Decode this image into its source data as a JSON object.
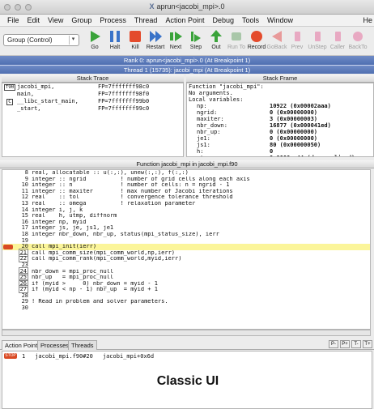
{
  "window": {
    "title": "aprun<jacobi_mpi>.0"
  },
  "menu": [
    "File",
    "Edit",
    "View",
    "Group",
    "Process",
    "Thread",
    "Action Point",
    "Debug",
    "Tools",
    "Window"
  ],
  "menu_help": "He",
  "toolbar": {
    "group_select": "Group (Control)",
    "buttons": [
      {
        "label": "Go",
        "icon": "go-icon",
        "color": "#3aa33a",
        "enabled": true
      },
      {
        "label": "Halt",
        "icon": "halt-icon",
        "color": "#3a73c8",
        "enabled": true
      },
      {
        "label": "Kill",
        "icon": "kill-icon",
        "color": "#e44b2c",
        "enabled": true
      },
      {
        "label": "Restart",
        "icon": "restart-icon",
        "color": "#3a73c8",
        "enabled": true
      },
      {
        "label": "Next",
        "icon": "next-icon",
        "color": "#3aa33a",
        "enabled": true
      },
      {
        "label": "Step",
        "icon": "step-icon",
        "color": "#3aa33a",
        "enabled": true
      },
      {
        "label": "Out",
        "icon": "out-icon",
        "color": "#3aa33a",
        "enabled": true
      },
      {
        "label": "Run To",
        "icon": "run-to-icon",
        "color": "#a9c7a9",
        "enabled": false
      },
      {
        "label": "Record",
        "icon": "record-icon",
        "color": "#e44b2c",
        "enabled": true
      },
      {
        "label": "GoBack",
        "icon": "goback-icon",
        "color": "#e89a9a",
        "enabled": false
      },
      {
        "label": "Prev",
        "icon": "prev-icon",
        "color": "#e8a9c2",
        "enabled": false
      },
      {
        "label": "UnStep",
        "icon": "unstep-icon",
        "color": "#e8a9c2",
        "enabled": false
      },
      {
        "label": "Caller",
        "icon": "caller-icon",
        "color": "#e8a9c2",
        "enabled": false
      },
      {
        "label": "BackTo",
        "icon": "backto-icon",
        "color": "#e8a9c2",
        "enabled": false
      },
      {
        "label": "L",
        "icon": "live-icon",
        "color": "#e8a9c2",
        "enabled": false
      }
    ]
  },
  "rank_bar": "Rank 0: aprun<jacobi_mpi>.0 (At Breakpoint 1)",
  "thread_bar": "Thread 1 (15735): jacobi_mpi (At Breakpoint 1)",
  "stack_trace": {
    "header": "Stack Trace",
    "rows": [
      {
        "lang": "f90",
        "func": "jacobi_mpi,",
        "fp": "FP=7fffffff98c0"
      },
      {
        "lang": "",
        "func": "main,",
        "fp": "FP=7fffffff98f0"
      },
      {
        "lang": "C",
        "func": "__libc_start_main,",
        "fp": "FP=7fffffff99b0"
      },
      {
        "lang": "",
        "func": "_start,",
        "fp": "FP=7fffffff99c0"
      }
    ]
  },
  "stack_frame": {
    "header": "Stack Frame",
    "lines": [
      "Function \"jacobi_mpi\":",
      " No arguments.",
      "Local variables:"
    ],
    "vars": [
      {
        "name": "np:",
        "value": "10922 (0x00002aaa)"
      },
      {
        "name": "ngrid:",
        "value": "0 (0x00000000)"
      },
      {
        "name": "maxiter:",
        "value": "3 (0x00000003)"
      },
      {
        "name": "nbr_down:",
        "value": "16877 (0x000041ed)"
      },
      {
        "name": "nbr_up:",
        "value": "0 (0x00000000)"
      },
      {
        "name": "je1:",
        "value": "0 (0x00000000)"
      },
      {
        "name": "js1:",
        "value": "80 (0x00000050)"
      },
      {
        "name": "h:",
        "value": "0"
      },
      {
        "name": "utmp:",
        "value": "0 0000e-44 (denormalized)"
      }
    ]
  },
  "source": {
    "header": "Function jacobi_mpi in jacobi_mpi.f90",
    "lines": [
      {
        "n": "8",
        "t": "real, allocatable :: u(:,:), unew(:,:), f(:,:)"
      },
      {
        "n": "9",
        "t": "integer :: ngrid          ! number of grid cells along each axis"
      },
      {
        "n": "10",
        "t": "integer :: n              ! number of cells: n = ngrid - 1"
      },
      {
        "n": "11",
        "t": "integer :: maxiter        ! max number of Jacobi iterations"
      },
      {
        "n": "12",
        "t": "real    :: tol            ! convergence tolerance threshold"
      },
      {
        "n": "13",
        "t": "real    :: omega          ! relaxation parameter"
      },
      {
        "n": "14",
        "t": "integer i, j, k"
      },
      {
        "n": "15",
        "t": "real    h, utmp, diffnorm"
      },
      {
        "n": "16",
        "t": "integer np, myid"
      },
      {
        "n": "17",
        "t": "integer js, je, js1, je1"
      },
      {
        "n": "18",
        "t": "integer nbr_down, nbr_up, status(mpi_status_size), ierr"
      },
      {
        "n": "19",
        "t": ""
      },
      {
        "n": "20",
        "t": "call mpi_init(ierr)",
        "current": true,
        "stop": true
      },
      {
        "n": "21",
        "t": "call mpi_comm_size(mpi_comm_world,np,ierr)",
        "boxed": true
      },
      {
        "n": "22",
        "t": "call mpi_comm_rank(mpi_comm_world,myid,ierr)",
        "boxed": true
      },
      {
        "n": "23",
        "t": ""
      },
      {
        "n": "24",
        "t": "nbr_down = mpi_proc_null",
        "boxed": true
      },
      {
        "n": "25",
        "t": "nbr_up   = mpi_proc_null",
        "boxed": true
      },
      {
        "n": "26",
        "t": "if (myid >     0) nbr_down = myid - 1",
        "boxed": true
      },
      {
        "n": "27",
        "t": "if (myid < np - 1) nbr_up  = myid + 1",
        "boxed": true
      },
      {
        "n": "28",
        "t": ""
      },
      {
        "n": "29",
        "t": "! Read in problem and solver parameters."
      },
      {
        "n": "30",
        "t": ""
      }
    ]
  },
  "tabs": [
    "Action Points",
    "Processes",
    "Threads"
  ],
  "nav_buttons": [
    "P-",
    "P+",
    "T-",
    "T+"
  ],
  "action_points": [
    {
      "stop": "STOP",
      "id": "1",
      "loc": "jacobi_mpi.f90#20",
      "addr": "jacobi_mpi+0x6d"
    }
  ],
  "overlay_label": "Classic UI"
}
